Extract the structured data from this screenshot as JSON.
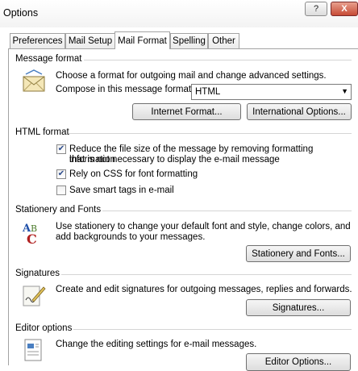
{
  "window": {
    "title": "Options",
    "help_label": "?",
    "close_label": "X"
  },
  "tabs": [
    {
      "label": "Preferences"
    },
    {
      "label": "Mail Setup"
    },
    {
      "label": "Mail Format"
    },
    {
      "label": "Spelling"
    },
    {
      "label": "Other"
    }
  ],
  "message_format": {
    "title": "Message format",
    "description": "Choose a format for outgoing mail and change advanced settings.",
    "compose_label": "Compose in this message format:",
    "compose_value": "HTML",
    "internet_format_button": "Internet Format...",
    "international_options_button": "International Options..."
  },
  "html_format": {
    "title": "HTML format",
    "options": [
      {
        "line1": "Reduce the file size of the message by removing formatting information",
        "line2": "that is not necessary to display the e-mail message",
        "checked": true
      },
      {
        "line1": "Rely on CSS for font formatting",
        "line2": "",
        "checked": true
      },
      {
        "line1": "Save smart tags in e-mail",
        "line2": "",
        "checked": false
      }
    ],
    "check_mark": "✔"
  },
  "stationery": {
    "title": "Stationery and Fonts",
    "line1": "Use stationery to change your default font and style, change colors, and",
    "line2": "add backgrounds to your messages.",
    "button": "Stationery and Fonts..."
  },
  "signatures": {
    "title": "Signatures",
    "description": "Create and edit signatures for outgoing messages, replies and forwards.",
    "button": "Signatures..."
  },
  "editor": {
    "title": "Editor options",
    "description": "Change the editing settings for e-mail messages.",
    "button": "Editor Options..."
  },
  "icons": {
    "envelope": "envelope-icon",
    "stationery": "abc-font-icon",
    "signature": "signature-pen-icon",
    "editor": "document-editor-icon"
  }
}
